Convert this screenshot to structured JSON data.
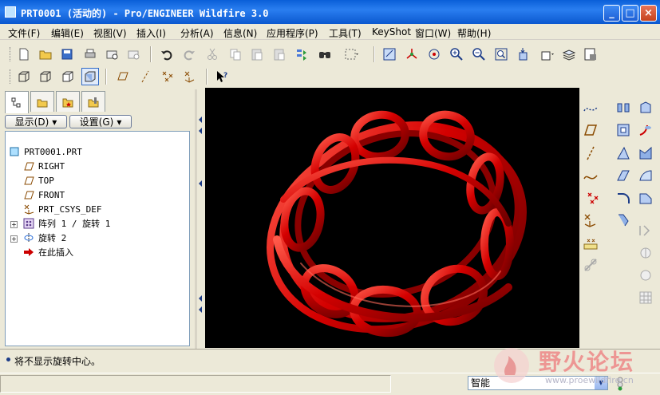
{
  "window": {
    "title": "PRT0001 (活动的) - Pro/ENGINEER Wildfire 3.0",
    "minimize": "_",
    "maximize": "□",
    "close": "×"
  },
  "menu": [
    "文件(F)",
    "编辑(E)",
    "视图(V)",
    "插入(I)",
    "分析(A)",
    "信息(N)",
    "应用程序(P)",
    "工具(T)",
    "KeyShot",
    "窗口(W)",
    "帮助(H)"
  ],
  "panel": {
    "display_btn": "显示(D)",
    "settings_btn": "设置(G)"
  },
  "tree": [
    {
      "label": "PRT0001.PRT",
      "icon": "part-icon"
    },
    {
      "label": "RIGHT",
      "icon": "datum-plane-icon"
    },
    {
      "label": "TOP",
      "icon": "datum-plane-icon"
    },
    {
      "label": "FRONT",
      "icon": "datum-plane-icon"
    },
    {
      "label": "PRT_CSYS_DEF",
      "icon": "csys-icon"
    },
    {
      "label": "阵列 1 / 旋转 1",
      "icon": "pattern-icon"
    },
    {
      "label": "旋转 2",
      "icon": "revolve-icon"
    },
    {
      "label": "在此插入",
      "icon": "insert-here-arrow-icon"
    }
  ],
  "status": {
    "message": "将不显示旋转中心。",
    "filter_value": "智能"
  },
  "watermark": {
    "title": "野火论坛",
    "url": "www.proewildfire.cn"
  },
  "colors": {
    "titlebar": "#0a5fd8",
    "model_red": "#d40000",
    "viewport_bg": "#000000"
  }
}
